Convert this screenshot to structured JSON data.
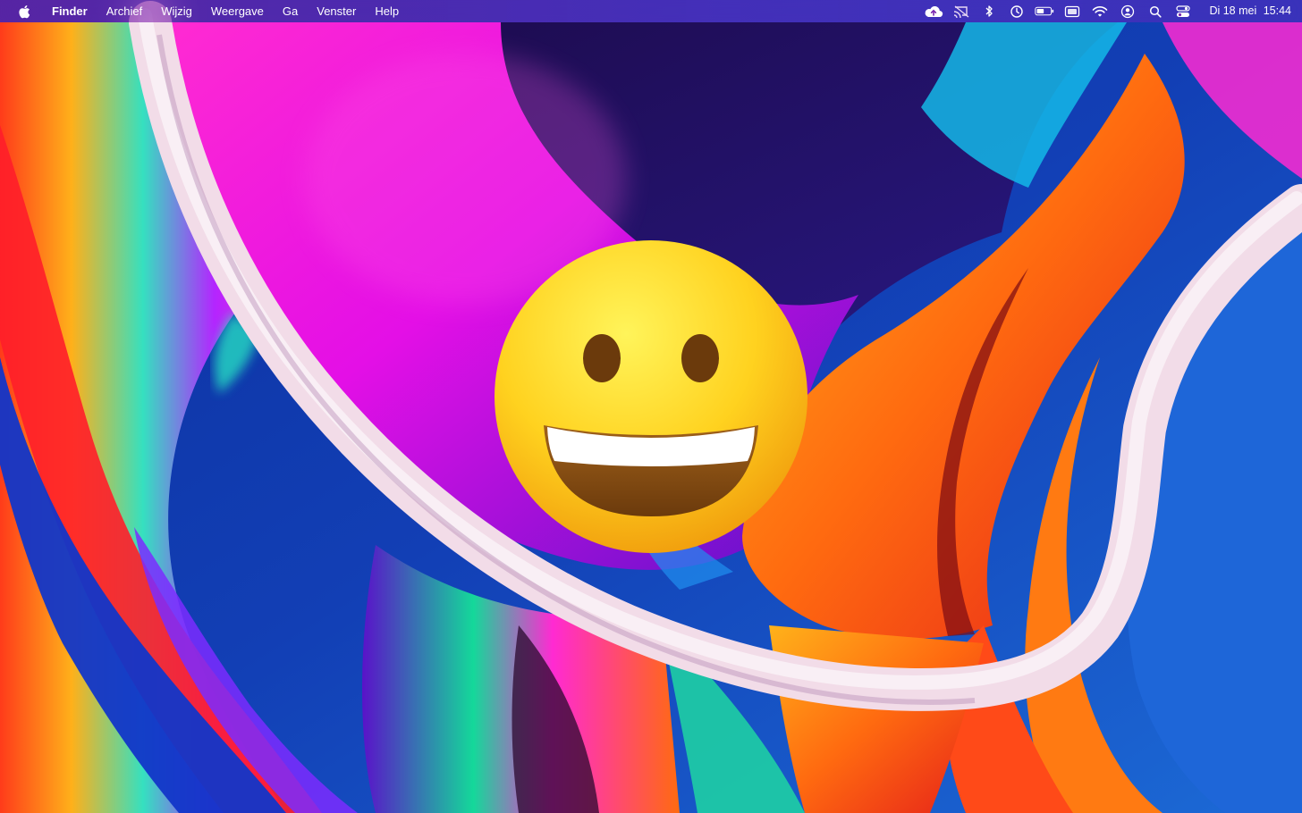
{
  "menubar": {
    "apple_icon": "apple-logo-icon",
    "items": [
      {
        "label": "Finder",
        "bold": true
      },
      {
        "label": "Archief"
      },
      {
        "label": "Wijzig"
      },
      {
        "label": "Weergave"
      },
      {
        "label": "Ga"
      },
      {
        "label": "Venster"
      },
      {
        "label": "Help"
      }
    ],
    "status_icons": [
      "icloud-upload-icon",
      "cast-off-icon",
      "bluetooth-icon",
      "time-machine-icon",
      "battery-icon",
      "display-icon",
      "wifi-icon",
      "user-icon",
      "search-icon",
      "control-center-icon"
    ],
    "clock": {
      "date": "Di 18 mei",
      "time": "15:44"
    }
  },
  "desktop": {
    "emoji_icon": "grinning-face-emoji-icon",
    "colors": {
      "background_blue": "#1a3fa8",
      "magenta": "#e10dd8",
      "orange": "#ff6a10",
      "emoji_yellow": "#ffd21f"
    }
  }
}
